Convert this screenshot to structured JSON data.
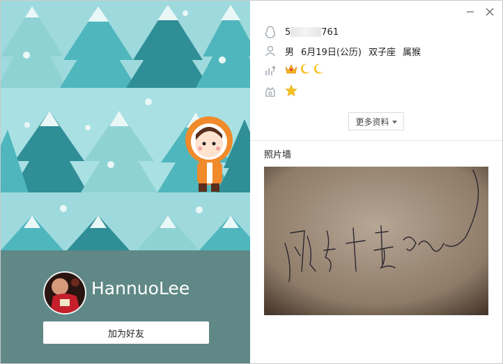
{
  "profile": {
    "qq_prefix": "5",
    "qq_suffix": "761",
    "gender": "男",
    "birthday": "6月19日(公历)",
    "zodiac": "双子座",
    "chinese_zodiac": "属猴",
    "nickname": "HannuoLee",
    "add_friend_label": "加为好友",
    "more_info_label": "更多资料",
    "photo_wall_title": "照片墙"
  },
  "icons": {
    "qq": "qq-penguin-icon",
    "person": "person-icon",
    "level": "level-chart-icon",
    "vip": "vip-badge-icon",
    "crown": "crown-icon",
    "moon": "moon-icon",
    "star": "star-icon",
    "minimize": "minimize-icon",
    "close": "close-icon",
    "dropdown": "dropdown-arrow-icon"
  },
  "colors": {
    "cover_bg": "#a8e0e3",
    "footer_bg": "#5f8886",
    "tree_dark": "#2f8e96",
    "tree_mid": "#4fb6bd",
    "tree_light": "#8fd2d4"
  }
}
